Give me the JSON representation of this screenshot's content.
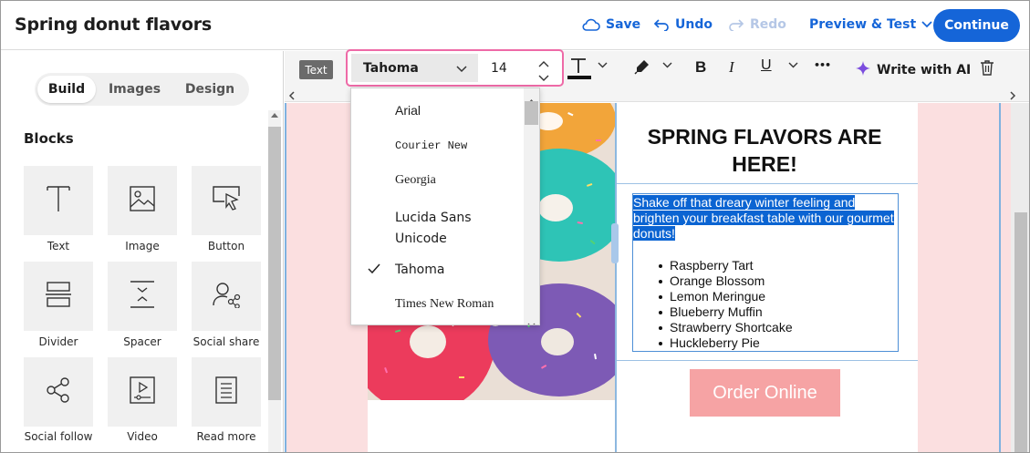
{
  "header": {
    "title": "Spring donut flavors",
    "save_label": "Save",
    "undo_label": "Undo",
    "redo_label": "Redo",
    "preview_label": "Preview & Test",
    "continue_label": "Continue"
  },
  "left_panel": {
    "tabs": [
      {
        "label": "Build",
        "active": true
      },
      {
        "label": "Images",
        "active": false
      },
      {
        "label": "Design",
        "active": false
      }
    ],
    "blocks_title": "Blocks",
    "blocks": [
      {
        "label": "Text",
        "icon": "text-icon"
      },
      {
        "label": "Image",
        "icon": "image-icon"
      },
      {
        "label": "Button",
        "icon": "button-icon"
      },
      {
        "label": "Divider",
        "icon": "divider-icon"
      },
      {
        "label": "Spacer",
        "icon": "spacer-icon"
      },
      {
        "label": "Social share",
        "icon": "social-share-icon"
      },
      {
        "label": "Social follow",
        "icon": "social-follow-icon"
      },
      {
        "label": "Video",
        "icon": "video-icon"
      },
      {
        "label": "Read more",
        "icon": "read-more-icon"
      }
    ]
  },
  "toolbar": {
    "text_tag": "Text",
    "font_family": "Tahoma",
    "font_size": "14",
    "write_ai_label": "Write with AI",
    "bold_label": "B",
    "italic_label": "I",
    "underline_label": "U",
    "more_label": "•••"
  },
  "font_dropdown": {
    "selected": "Tahoma",
    "options": [
      "Arial",
      "Courier New",
      "Georgia",
      "Lucida Sans Unicode",
      "Tahoma",
      "Times New Roman"
    ]
  },
  "email": {
    "headline": "SPRING FLAVORS ARE HERE!",
    "intro_text": "Shake off that dreary winter feeling and brighten your breakfast table with our gourmet donuts!",
    "intro_lines": [
      "Shake off that dreary winter feeling and",
      "brighten your breakfast table with our gourmet",
      "donuts!"
    ],
    "flavors": [
      "Raspberry Tart",
      "Orange Blossom",
      "Lemon Meringue",
      "Blueberry Muffin",
      "Strawberry Shortcake",
      "Huckleberry Pie"
    ],
    "button_label": "Order Online"
  },
  "colors": {
    "accent": "#1565d8",
    "highlight_border": "#ee6aa7",
    "canvas_bg": "#fbdfe0",
    "order_button": "#f6a3a4",
    "selection": "#0b64d2"
  }
}
